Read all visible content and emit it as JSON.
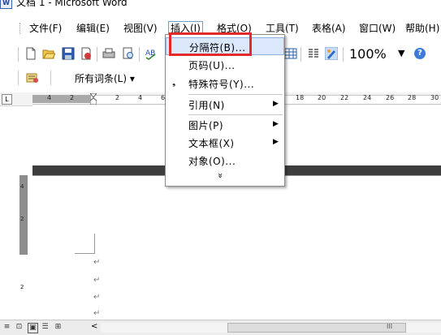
{
  "window": {
    "title": "文档 1 - Microsoft Word",
    "icon": "word-doc-icon"
  },
  "menubar": {
    "items": [
      {
        "label": "文件(F)"
      },
      {
        "label": "编辑(E)"
      },
      {
        "label": "视图(V)"
      },
      {
        "label": "插入(I)"
      },
      {
        "label": "格式(O)"
      },
      {
        "label": "工具(T)"
      },
      {
        "label": "表格(A)"
      },
      {
        "label": "窗口(W)"
      },
      {
        "label": "帮助(H)"
      }
    ]
  },
  "toolbar": {
    "icons": [
      "new-doc-icon",
      "open-icon",
      "save-icon",
      "permission-icon",
      "print-icon",
      "print-preview-icon",
      "spelling-icon",
      "table-icon",
      "columns-icon",
      "drawing-icon"
    ],
    "zoom": "100%",
    "help_icon": "help-icon"
  },
  "toolbar2": {
    "autotext_label": "所有词条(L) ▾"
  },
  "ruler": {
    "ticks": [
      "4",
      "2",
      "2",
      "4",
      "6",
      "18",
      "20",
      "22",
      "24",
      "26",
      "28",
      "30"
    ],
    "vticks": [
      "4",
      "2",
      "2"
    ]
  },
  "insert_menu": {
    "items": [
      {
        "label": "分隔符(B)...",
        "highlighted": true
      },
      {
        "label": "页码(U)..."
      },
      {
        "label": "特殊符号(Y)...",
        "bullet": true
      },
      {
        "label": "引用(N)",
        "submenu": true
      },
      {
        "label": "图片(P)",
        "submenu": true
      },
      {
        "label": "文本框(X)",
        "submenu": true
      },
      {
        "label": "对象(O)..."
      }
    ],
    "expand_glyph": "»"
  },
  "colors": {
    "highlight_border": "#e32b2b",
    "menu_hover": "#dbe8fb",
    "page_break_band": "#3d3d3d"
  },
  "statusbar": {
    "scroll_grip": "III"
  }
}
